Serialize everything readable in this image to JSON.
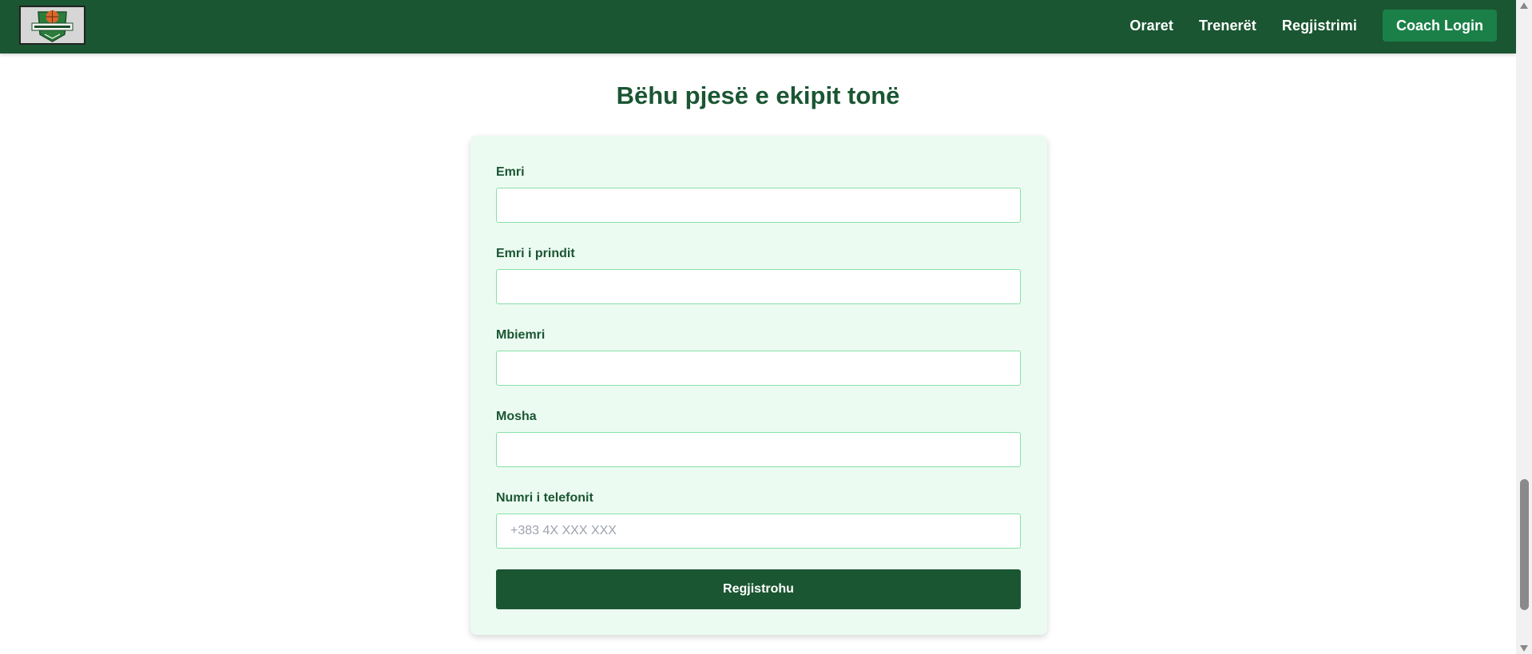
{
  "header": {
    "logo_icon": "basketball-club-logo",
    "nav": [
      {
        "label": "Oraret"
      },
      {
        "label": "Trenerët"
      },
      {
        "label": "Regjistrimi"
      }
    ],
    "coach_login_label": "Coach Login"
  },
  "main": {
    "title": "Bëhu pjesë e ekipit tonë",
    "form": {
      "fields": [
        {
          "label": "Emri",
          "value": "",
          "placeholder": ""
        },
        {
          "label": "Emri i prindit",
          "value": "",
          "placeholder": ""
        },
        {
          "label": "Mbiemri",
          "value": "",
          "placeholder": ""
        },
        {
          "label": "Mosha",
          "value": "",
          "placeholder": ""
        },
        {
          "label": "Numri i telefonit",
          "value": "",
          "placeholder": "+383 4X XXX XXX"
        }
      ],
      "submit_label": "Regjistrohu"
    }
  },
  "colors": {
    "primary": "#1a5632",
    "accent": "#1b8048",
    "card_bg": "#ecfbf1",
    "input_border": "#86e0a8"
  }
}
